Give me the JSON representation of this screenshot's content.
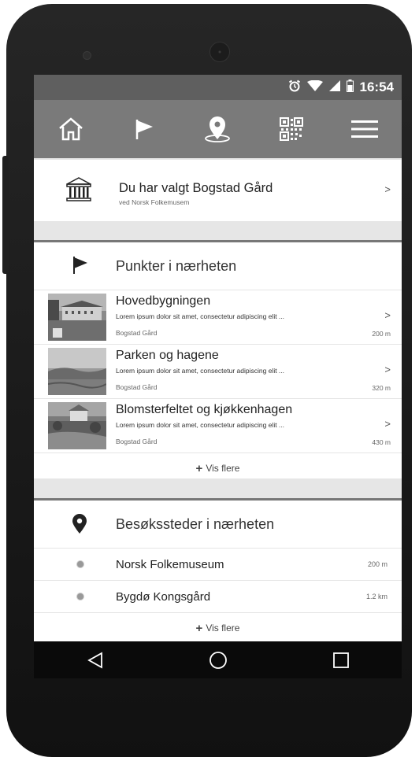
{
  "status": {
    "time": "16:54"
  },
  "appbar": {
    "icons": [
      "home-icon",
      "flag-icon",
      "location-pin-icon",
      "qr-code-icon",
      "menu-icon"
    ]
  },
  "selection": {
    "title": "Du har valgt Bogstad Gård",
    "subtitle": "ved Norsk Folkemusem",
    "chevron": ">"
  },
  "points": {
    "heading": "Punkter i nærheten",
    "items": [
      {
        "title": "Hovedbygningen",
        "desc": "Lorem ipsum dolor sit amet, consectetur adipiscing elit ...",
        "location": "Bogstad Gård",
        "distance": "200 m",
        "chevron": ">"
      },
      {
        "title": "Parken og hagene",
        "desc": "Lorem ipsum dolor sit amet, consectetur adipiscing elit ...",
        "location": "Bogstad Gård",
        "distance": "320 m",
        "chevron": ">"
      },
      {
        "title": "Blomsterfeltet og kjøkkenhagen",
        "desc": "Lorem ipsum dolor sit amet, consectetur adipiscing elit ...",
        "location": "Bogstad Gård",
        "distance": "430 m",
        "chevron": ">"
      }
    ],
    "more_label": "Vis flere",
    "more_plus": "+"
  },
  "places": {
    "heading": "Besøkssteder i nærheten",
    "items": [
      {
        "name": "Norsk Folkemuseum",
        "distance": "200 m"
      },
      {
        "name": "Bygdø Kongsgård",
        "distance": "1.2 km"
      }
    ],
    "more_label": "Vis flere",
    "more_plus": "+"
  },
  "colors": {
    "appbar": "#7a7a7a",
    "statusbar": "#5f5f5f",
    "navbar": "#0a0a0a",
    "divider": "#777777"
  }
}
